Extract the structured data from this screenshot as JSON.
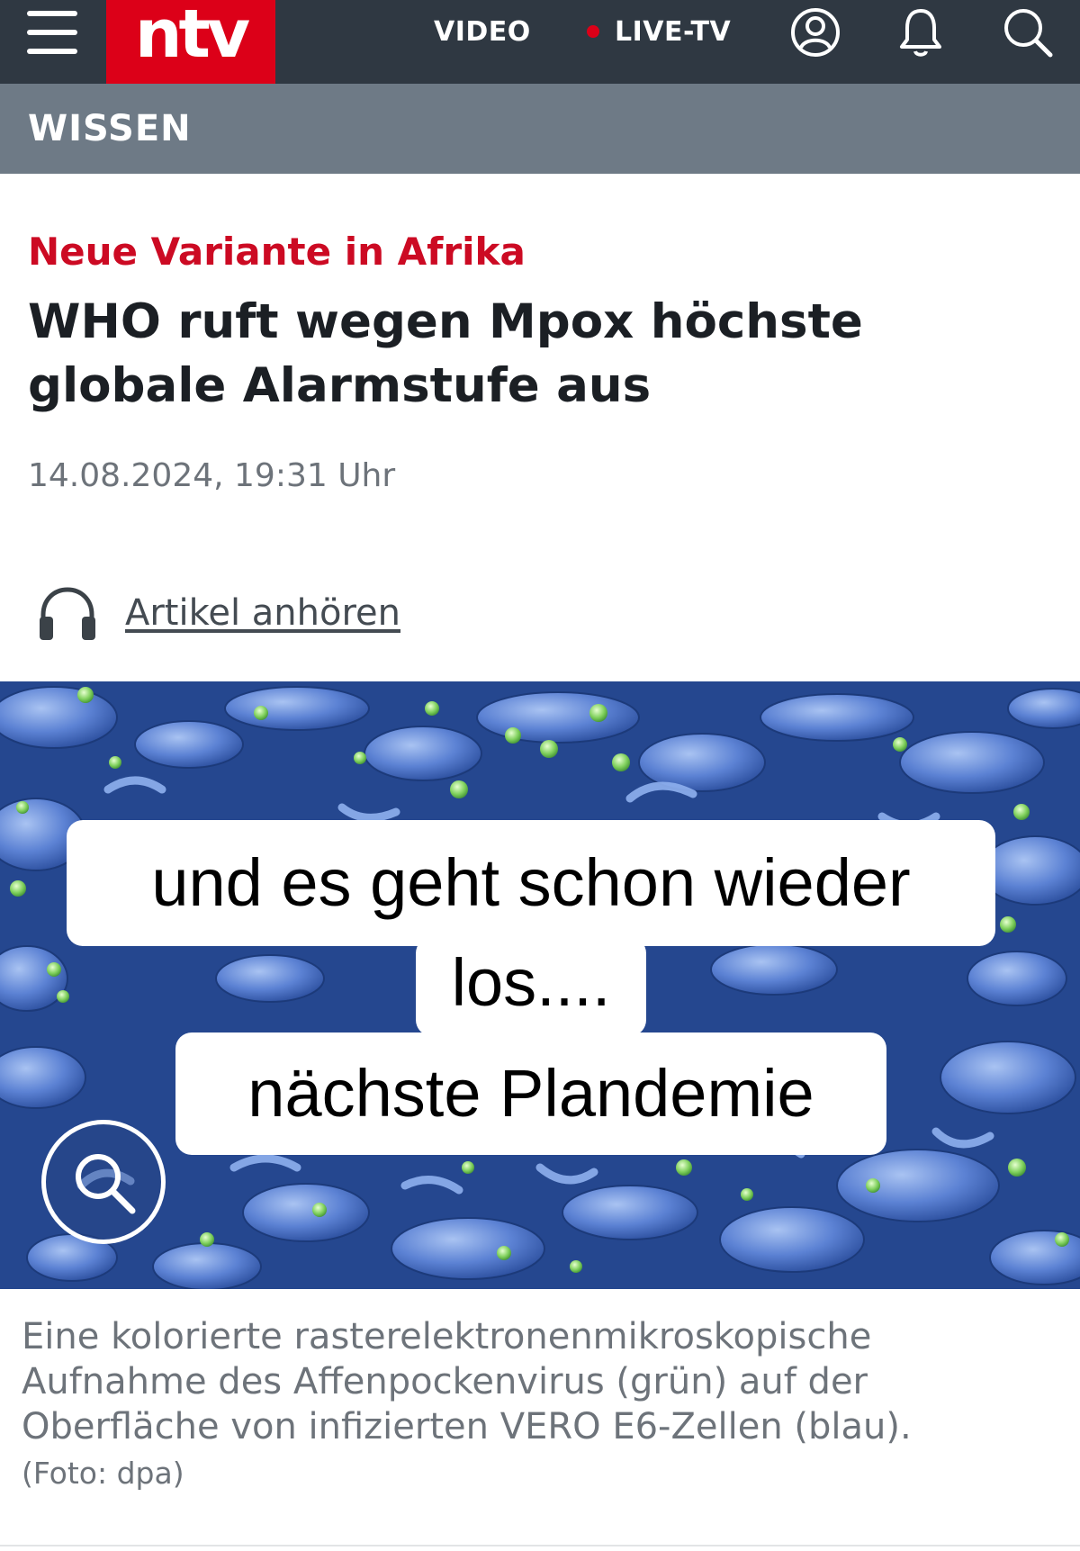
{
  "header": {
    "logo_text": "ntv",
    "nav": {
      "video_label": "VIDEO",
      "live_label": "LIVE-TV"
    },
    "icons": [
      "menu-icon",
      "account-icon",
      "bell-icon",
      "search-icon"
    ],
    "colors": {
      "bar": "#2f3842",
      "brand": "#dc0018",
      "section_bar": "#6e7a86"
    }
  },
  "section": {
    "label": "WISSEN"
  },
  "article": {
    "kicker": "Neue Variante in Afrika",
    "headline": "WHO ruft wegen Mpox höchste globale Alarmstufe aus",
    "date": "14.08.2024, 19:31 Uhr",
    "audio_label": "Artikel anhören",
    "kicker_color": "#cc0a23"
  },
  "hero": {
    "overlay_lines": [
      "und es geht schon wieder",
      "los....",
      "nächste Plandemie"
    ],
    "zoom_icon": "magnifier-icon",
    "caption": "Eine kolorierte rasterelektronenmikroskopische Aufnahme des Affenpockenvirus (grün) auf der Oberfläche von infizierten VERO E6-Zellen (blau).",
    "credit": "(Foto: dpa)"
  }
}
